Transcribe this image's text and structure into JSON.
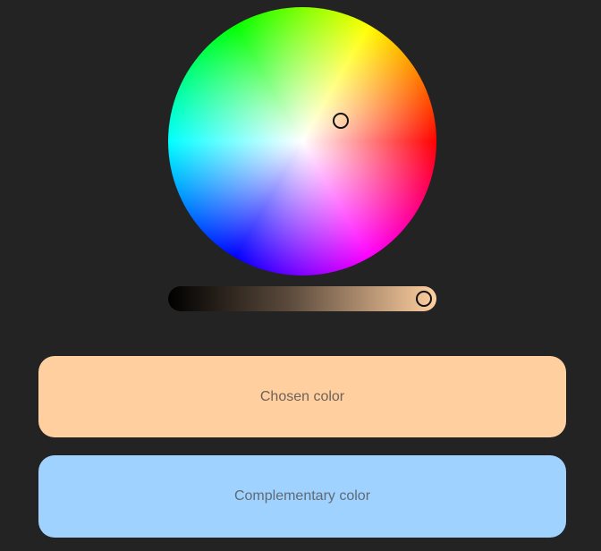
{
  "color_picker": {
    "wheel": {
      "icon": "hue-saturation-wheel"
    },
    "brightness_slider": {
      "icon": "brightness-gradient"
    }
  },
  "swatches": {
    "chosen": {
      "label": "Chosen color",
      "color": "#ffcfa0"
    },
    "complementary": {
      "label": "Complementary color",
      "color": "#a0d2ff"
    }
  },
  "theme": {
    "background": "#232323"
  }
}
